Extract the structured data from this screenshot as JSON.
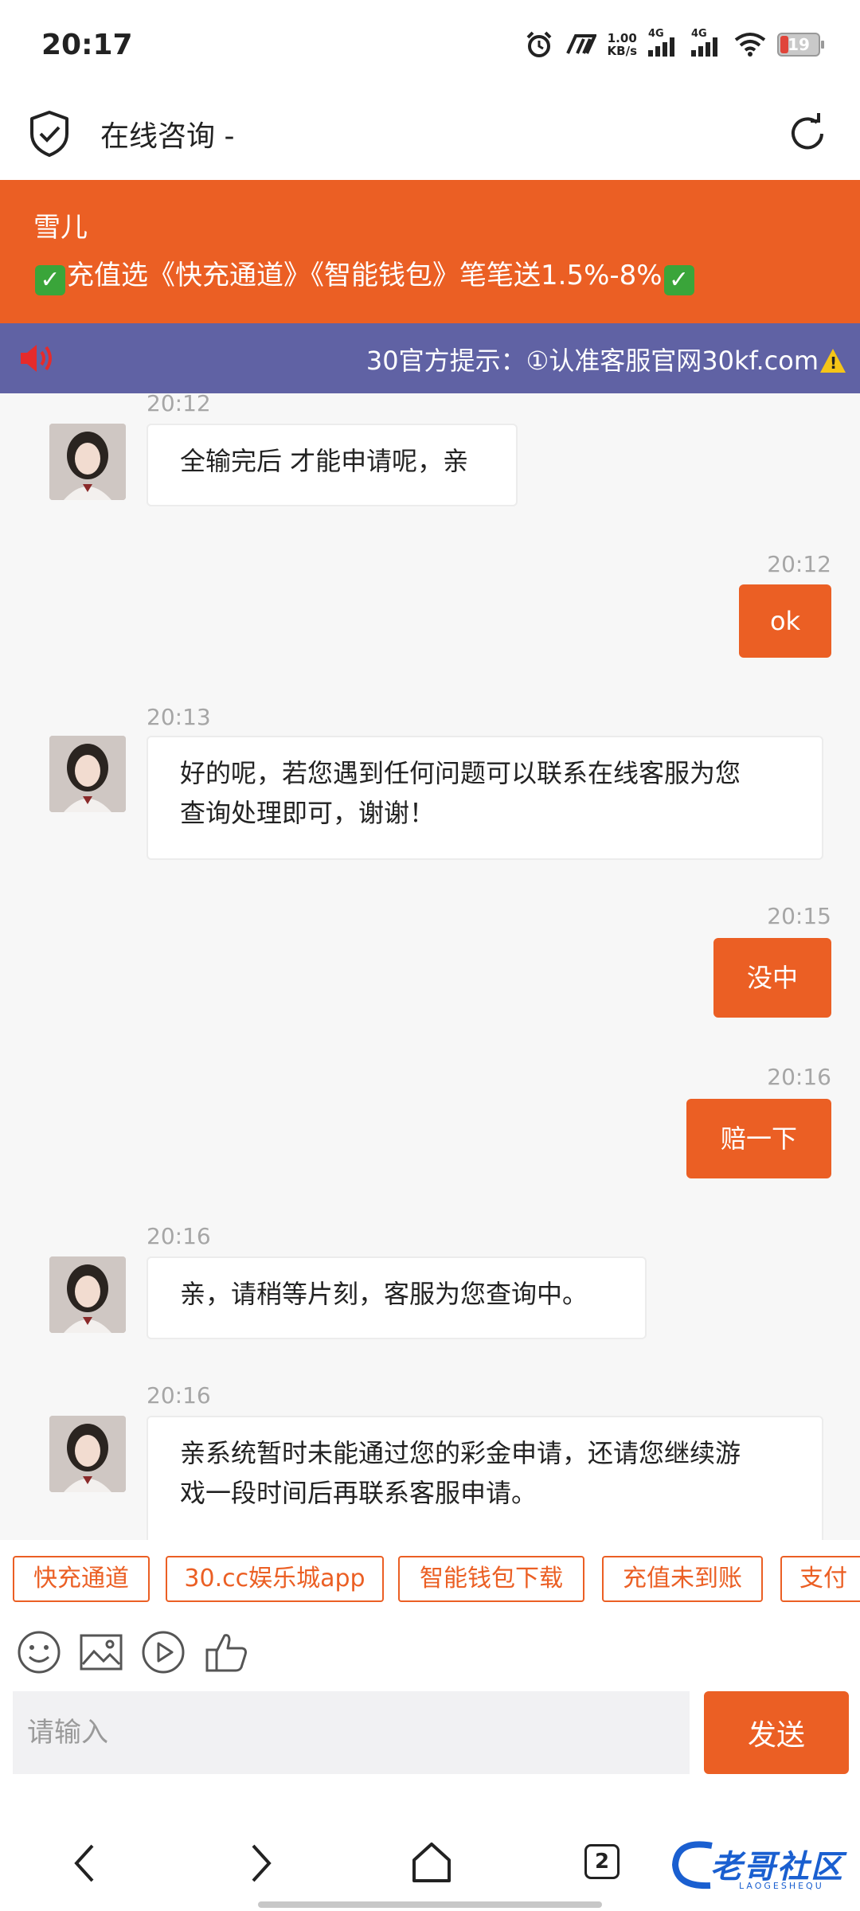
{
  "status_bar": {
    "time": "20:17",
    "net_speed_value": "1.00",
    "net_speed_unit": "KB/s",
    "signal1_label": "4G",
    "signal2_label": "4G",
    "battery_level": "19"
  },
  "toolbar": {
    "title": "在线咨询 -"
  },
  "chat_header": {
    "agent_name": "雪儿",
    "promo_text": "充值选《快充通道》《智能钱包》笔笔送1.5%-8%"
  },
  "notice": {
    "text": "30官方提示：①认准客服官网30kf.com"
  },
  "messages": [
    {
      "side": "in",
      "time": "20:12",
      "lines": [
        "全输完后 才能申请呢，亲"
      ]
    },
    {
      "side": "out",
      "time": "20:12",
      "text": "ok"
    },
    {
      "side": "in",
      "time": "20:13",
      "lines": [
        "好的呢，若您遇到任何问题可以联系在线客服为您",
        "查询处理即可，谢谢！"
      ]
    },
    {
      "side": "out",
      "time": "20:15",
      "text": "没中"
    },
    {
      "side": "out",
      "time": "20:16",
      "text": "赔一下"
    },
    {
      "side": "in",
      "time": "20:16",
      "lines": [
        "亲，请稍等片刻，客服为您查询中。"
      ]
    },
    {
      "side": "in",
      "time": "20:16",
      "lines": [
        "亲系统暂时未能通过您的彩金申请，还请您继续游",
        "戏一段时间后再联系客服申请。"
      ]
    }
  ],
  "quick_replies": [
    "快充通道",
    "30.cc娱乐城app",
    "智能钱包下载",
    "充值未到账",
    "支付"
  ],
  "input": {
    "placeholder": "请输入",
    "send_label": "发送"
  },
  "navbar": {
    "tab_count": "2",
    "watermark_text": "老哥社区",
    "watermark_sub": "LAOGESHEQU"
  },
  "colors": {
    "accent": "#eb5f24",
    "notice_bg": "#6062a4",
    "page_bg": "#f7f7f7"
  }
}
